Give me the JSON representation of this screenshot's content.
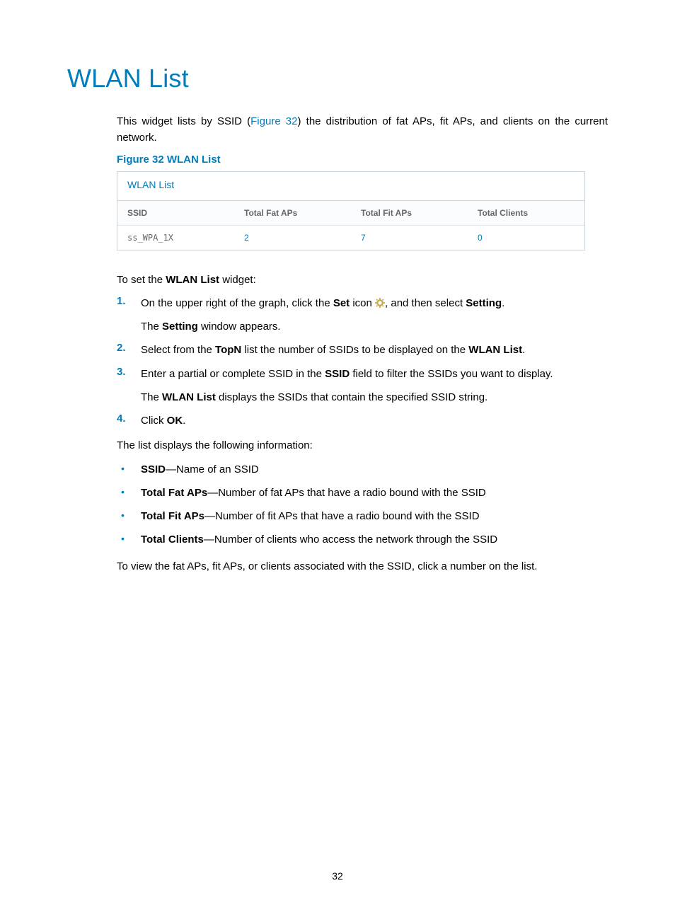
{
  "title": "WLAN List",
  "intro_parts": {
    "a": "This widget lists by SSID (",
    "link": "Figure 32",
    "b": ") the distribution of fat APs, fit APs, and clients on the current network."
  },
  "fig_caption": "Figure 32 WLAN List",
  "widget": {
    "title": "WLAN List",
    "headers": [
      "SSID",
      "Total Fat APs",
      "Total Fit APs",
      "Total Clients"
    ],
    "row": {
      "ssid": "ss_WPA_1X",
      "fat": "2",
      "fit": "7",
      "clients": "0"
    }
  },
  "set_intro_a": "To set the ",
  "set_intro_b": "WLAN List",
  "set_intro_c": " widget:",
  "steps": {
    "s1": {
      "num": "1.",
      "a": "On the upper right of the graph, click the ",
      "b": "Set",
      "c": " icon ",
      "d": ", and then select ",
      "e": "Setting",
      "f": ".",
      "sub_a": "The ",
      "sub_b": "Setting",
      "sub_c": " window appears."
    },
    "s2": {
      "num": "2.",
      "a": "Select from the ",
      "b": "TopN",
      "c": " list the number of SSIDs to be displayed on the ",
      "d": "WLAN List",
      "e": "."
    },
    "s3": {
      "num": "3.",
      "a": "Enter a partial or complete SSID in the ",
      "b": "SSID",
      "c": " field to filter the SSIDs you want to display.",
      "sub_a": "The ",
      "sub_b": "WLAN List",
      "sub_c": " displays the SSIDs that contain the specified SSID string."
    },
    "s4": {
      "num": "4.",
      "a": "Click ",
      "b": "OK",
      "c": "."
    }
  },
  "list_intro": "The list displays the following information:",
  "bullets": {
    "b1": {
      "t": "SSID",
      "d": "—Name of an SSID"
    },
    "b2": {
      "t": "Total Fat APs",
      "d": "—Number of fat APs that have a radio bound with the SSID"
    },
    "b3": {
      "t": "Total Fit APs",
      "d": "—Number of fit APs that have a radio bound with the SSID"
    },
    "b4": {
      "t": "Total Clients",
      "d": "—Number of clients who access the network through the SSID"
    }
  },
  "closing": "To view the fat APs, fit APs, or clients associated with the SSID, click a number on the list.",
  "dot": "•",
  "page_number": "32"
}
